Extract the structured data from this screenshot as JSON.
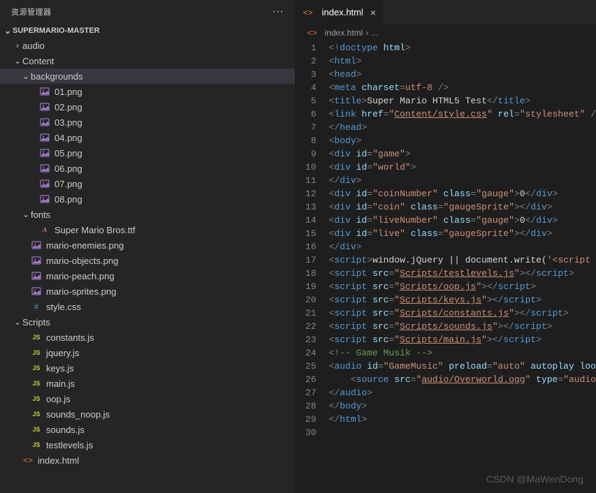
{
  "sidebar": {
    "title": "资源管理器",
    "project": "SUPERMARIO-MASTER",
    "tree": [
      {
        "label": "audio",
        "type": "folder",
        "open": false,
        "depth": 1
      },
      {
        "label": "Content",
        "type": "folder",
        "open": true,
        "depth": 1
      },
      {
        "label": "backgrounds",
        "type": "folder",
        "open": true,
        "depth": 2,
        "selected": true
      },
      {
        "label": "01.png",
        "type": "img",
        "depth": 3
      },
      {
        "label": "02.png",
        "type": "img",
        "depth": 3
      },
      {
        "label": "03.png",
        "type": "img",
        "depth": 3
      },
      {
        "label": "04.png",
        "type": "img",
        "depth": 3
      },
      {
        "label": "05.png",
        "type": "img",
        "depth": 3
      },
      {
        "label": "06.png",
        "type": "img",
        "depth": 3
      },
      {
        "label": "07.png",
        "type": "img",
        "depth": 3
      },
      {
        "label": "08.png",
        "type": "img",
        "depth": 3
      },
      {
        "label": "fonts",
        "type": "folder",
        "open": true,
        "depth": 2
      },
      {
        "label": "Super Mario Bros.ttf",
        "type": "font",
        "depth": 3
      },
      {
        "label": "mario-enemies.png",
        "type": "img",
        "depth": 2
      },
      {
        "label": "mario-objects.png",
        "type": "img",
        "depth": 2
      },
      {
        "label": "mario-peach.png",
        "type": "img",
        "depth": 2
      },
      {
        "label": "mario-sprites.png",
        "type": "img",
        "depth": 2
      },
      {
        "label": "style.css",
        "type": "css",
        "depth": 2
      },
      {
        "label": "Scripts",
        "type": "folder",
        "open": true,
        "depth": 1
      },
      {
        "label": "constants.js",
        "type": "js",
        "depth": 2
      },
      {
        "label": "jquery.js",
        "type": "js",
        "depth": 2
      },
      {
        "label": "keys.js",
        "type": "js",
        "depth": 2
      },
      {
        "label": "main.js",
        "type": "js",
        "depth": 2
      },
      {
        "label": "oop.js",
        "type": "js",
        "depth": 2
      },
      {
        "label": "sounds_noop.js",
        "type": "js",
        "depth": 2
      },
      {
        "label": "sounds.js",
        "type": "js",
        "depth": 2
      },
      {
        "label": "testlevels.js",
        "type": "js",
        "depth": 2
      },
      {
        "label": "index.html",
        "type": "html",
        "depth": 1
      }
    ]
  },
  "editor": {
    "tab": {
      "filename": "index.html"
    },
    "breadcrumb": {
      "file": "index.html",
      "more": "..."
    },
    "lines": [
      {
        "n": 1,
        "tokens": [
          [
            "<!",
            "bracket"
          ],
          [
            "doctype ",
            "doctype"
          ],
          [
            "html",
            "attr"
          ],
          [
            ">",
            "bracket"
          ]
        ]
      },
      {
        "n": 2,
        "tokens": [
          [
            "<",
            "bracket"
          ],
          [
            "html",
            "tag"
          ],
          [
            ">",
            "bracket"
          ]
        ]
      },
      {
        "n": 3,
        "tokens": [
          [
            "<",
            "bracket"
          ],
          [
            "head",
            "tag"
          ],
          [
            ">",
            "bracket"
          ]
        ]
      },
      {
        "n": 4,
        "tokens": [
          [
            "<",
            "bracket"
          ],
          [
            "meta ",
            "tag"
          ],
          [
            "charset",
            "attr"
          ],
          [
            "=",
            "bracket"
          ],
          [
            "utf-8",
            "str"
          ],
          [
            " />",
            "bracket"
          ]
        ]
      },
      {
        "n": 5,
        "tokens": [
          [
            "<",
            "bracket"
          ],
          [
            "title",
            "tag"
          ],
          [
            ">",
            "bracket"
          ],
          [
            "Super Mario HTML5 Test",
            "text"
          ],
          [
            "</",
            "bracket"
          ],
          [
            "title",
            "tag"
          ],
          [
            ">",
            "bracket"
          ]
        ]
      },
      {
        "n": 6,
        "tokens": [
          [
            "<",
            "bracket"
          ],
          [
            "link ",
            "tag"
          ],
          [
            "href",
            "attr"
          ],
          [
            "=",
            "bracket"
          ],
          [
            "\"",
            "str"
          ],
          [
            "Content/style.css",
            "str-u"
          ],
          [
            "\" ",
            "str"
          ],
          [
            "rel",
            "attr"
          ],
          [
            "=",
            "bracket"
          ],
          [
            "\"stylesheet\"",
            "str"
          ],
          [
            " /",
            "bracket"
          ]
        ]
      },
      {
        "n": 7,
        "tokens": [
          [
            "</",
            "bracket"
          ],
          [
            "head",
            "tag"
          ],
          [
            ">",
            "bracket"
          ]
        ]
      },
      {
        "n": 8,
        "tokens": [
          [
            "<",
            "bracket"
          ],
          [
            "body",
            "tag"
          ],
          [
            ">",
            "bracket"
          ]
        ]
      },
      {
        "n": 9,
        "tokens": [
          [
            "<",
            "bracket"
          ],
          [
            "div ",
            "tag"
          ],
          [
            "id",
            "attr"
          ],
          [
            "=",
            "bracket"
          ],
          [
            "\"game\"",
            "str"
          ],
          [
            ">",
            "bracket"
          ]
        ]
      },
      {
        "n": 10,
        "tokens": [
          [
            "<",
            "bracket"
          ],
          [
            "div ",
            "tag"
          ],
          [
            "id",
            "attr"
          ],
          [
            "=",
            "bracket"
          ],
          [
            "\"world\"",
            "str"
          ],
          [
            ">",
            "bracket"
          ]
        ]
      },
      {
        "n": 11,
        "tokens": [
          [
            "</",
            "bracket"
          ],
          [
            "div",
            "tag"
          ],
          [
            ">",
            "bracket"
          ]
        ]
      },
      {
        "n": 12,
        "tokens": [
          [
            "<",
            "bracket"
          ],
          [
            "div ",
            "tag"
          ],
          [
            "id",
            "attr"
          ],
          [
            "=",
            "bracket"
          ],
          [
            "\"coinNumber\" ",
            "str"
          ],
          [
            "class",
            "attr"
          ],
          [
            "=",
            "bracket"
          ],
          [
            "\"gauge\"",
            "str"
          ],
          [
            ">",
            "bracket"
          ],
          [
            "0",
            "text"
          ],
          [
            "</",
            "bracket"
          ],
          [
            "div",
            "tag"
          ],
          [
            ">",
            "bracket"
          ]
        ]
      },
      {
        "n": 13,
        "tokens": [
          [
            "<",
            "bracket"
          ],
          [
            "div ",
            "tag"
          ],
          [
            "id",
            "attr"
          ],
          [
            "=",
            "bracket"
          ],
          [
            "\"coin\" ",
            "str"
          ],
          [
            "class",
            "attr"
          ],
          [
            "=",
            "bracket"
          ],
          [
            "\"gaugeSprite\"",
            "str"
          ],
          [
            ">",
            "bracket"
          ],
          [
            "</",
            "bracket"
          ],
          [
            "div",
            "tag"
          ],
          [
            ">",
            "bracket"
          ]
        ]
      },
      {
        "n": 14,
        "tokens": [
          [
            "<",
            "bracket"
          ],
          [
            "div ",
            "tag"
          ],
          [
            "id",
            "attr"
          ],
          [
            "=",
            "bracket"
          ],
          [
            "\"liveNumber\" ",
            "str"
          ],
          [
            "class",
            "attr"
          ],
          [
            "=",
            "bracket"
          ],
          [
            "\"gauge\"",
            "str"
          ],
          [
            ">",
            "bracket"
          ],
          [
            "0",
            "text"
          ],
          [
            "</",
            "bracket"
          ],
          [
            "div",
            "tag"
          ],
          [
            ">",
            "bracket"
          ]
        ]
      },
      {
        "n": 15,
        "tokens": [
          [
            "<",
            "bracket"
          ],
          [
            "div ",
            "tag"
          ],
          [
            "id",
            "attr"
          ],
          [
            "=",
            "bracket"
          ],
          [
            "\"live\" ",
            "str"
          ],
          [
            "class",
            "attr"
          ],
          [
            "=",
            "bracket"
          ],
          [
            "\"gaugeSprite\"",
            "str"
          ],
          [
            ">",
            "bracket"
          ],
          [
            "</",
            "bracket"
          ],
          [
            "div",
            "tag"
          ],
          [
            ">",
            "bracket"
          ]
        ]
      },
      {
        "n": 16,
        "tokens": [
          [
            "</",
            "bracket"
          ],
          [
            "div",
            "tag"
          ],
          [
            ">",
            "bracket"
          ]
        ]
      },
      {
        "n": 17,
        "tokens": [
          [
            "<",
            "bracket"
          ],
          [
            "script",
            "tag"
          ],
          [
            ">",
            "bracket"
          ],
          [
            "window.jQuery || document.write(",
            "text"
          ],
          [
            "'<script ",
            "str"
          ]
        ]
      },
      {
        "n": 18,
        "tokens": [
          [
            "<",
            "bracket"
          ],
          [
            "script ",
            "tag"
          ],
          [
            "src",
            "attr"
          ],
          [
            "=",
            "bracket"
          ],
          [
            "\"",
            "str"
          ],
          [
            "Scripts/testlevels.js",
            "str-u"
          ],
          [
            "\"",
            "str"
          ],
          [
            ">",
            "bracket"
          ],
          [
            "</",
            "bracket"
          ],
          [
            "script",
            "tag"
          ],
          [
            ">",
            "bracket"
          ]
        ]
      },
      {
        "n": 19,
        "tokens": [
          [
            "<",
            "bracket"
          ],
          [
            "script ",
            "tag"
          ],
          [
            "src",
            "attr"
          ],
          [
            "=",
            "bracket"
          ],
          [
            "\"",
            "str"
          ],
          [
            "Scripts/oop.js",
            "str-u"
          ],
          [
            "\"",
            "str"
          ],
          [
            ">",
            "bracket"
          ],
          [
            "</",
            "bracket"
          ],
          [
            "script",
            "tag"
          ],
          [
            ">",
            "bracket"
          ]
        ]
      },
      {
        "n": 20,
        "tokens": [
          [
            "<",
            "bracket"
          ],
          [
            "script ",
            "tag"
          ],
          [
            "src",
            "attr"
          ],
          [
            "=",
            "bracket"
          ],
          [
            "\"",
            "str"
          ],
          [
            "Scripts/keys.js",
            "str-u"
          ],
          [
            "\"",
            "str"
          ],
          [
            ">",
            "bracket"
          ],
          [
            "</",
            "bracket"
          ],
          [
            "script",
            "tag"
          ],
          [
            ">",
            "bracket"
          ]
        ]
      },
      {
        "n": 21,
        "tokens": [
          [
            "<",
            "bracket"
          ],
          [
            "script ",
            "tag"
          ],
          [
            "src",
            "attr"
          ],
          [
            "=",
            "bracket"
          ],
          [
            "\"",
            "str"
          ],
          [
            "Scripts/constants.js",
            "str-u"
          ],
          [
            "\"",
            "str"
          ],
          [
            ">",
            "bracket"
          ],
          [
            "</",
            "bracket"
          ],
          [
            "script",
            "tag"
          ],
          [
            ">",
            "bracket"
          ]
        ]
      },
      {
        "n": 22,
        "tokens": [
          [
            "<",
            "bracket"
          ],
          [
            "script ",
            "tag"
          ],
          [
            "src",
            "attr"
          ],
          [
            "=",
            "bracket"
          ],
          [
            "\"",
            "str"
          ],
          [
            "Scripts/sounds.js",
            "str-u"
          ],
          [
            "\"",
            "str"
          ],
          [
            ">",
            "bracket"
          ],
          [
            "</",
            "bracket"
          ],
          [
            "script",
            "tag"
          ],
          [
            ">",
            "bracket"
          ]
        ]
      },
      {
        "n": 23,
        "tokens": [
          [
            "<",
            "bracket"
          ],
          [
            "script ",
            "tag"
          ],
          [
            "src",
            "attr"
          ],
          [
            "=",
            "bracket"
          ],
          [
            "\"",
            "str"
          ],
          [
            "Scripts/main.js",
            "str-u"
          ],
          [
            "\"",
            "str"
          ],
          [
            ">",
            "bracket"
          ],
          [
            "</",
            "bracket"
          ],
          [
            "script",
            "tag"
          ],
          [
            ">",
            "bracket"
          ]
        ]
      },
      {
        "n": 24,
        "tokens": [
          [
            "<!-- Game Musik -->",
            "comment"
          ]
        ]
      },
      {
        "n": 25,
        "tokens": [
          [
            "<",
            "bracket"
          ],
          [
            "audio ",
            "tag"
          ],
          [
            "id",
            "attr"
          ],
          [
            "=",
            "bracket"
          ],
          [
            "\"GameMusic\" ",
            "str"
          ],
          [
            "preload",
            "attr"
          ],
          [
            "=",
            "bracket"
          ],
          [
            "\"auto\" ",
            "str"
          ],
          [
            "autoplay ",
            "attr"
          ],
          [
            "loo",
            "attr"
          ]
        ]
      },
      {
        "n": 26,
        "tokens": [
          [
            "    ",
            "text"
          ],
          [
            "<",
            "bracket"
          ],
          [
            "source ",
            "tag"
          ],
          [
            "src",
            "attr"
          ],
          [
            "=",
            "bracket"
          ],
          [
            "\"",
            "str"
          ],
          [
            "audio/Overworld.ogg",
            "str-u"
          ],
          [
            "\" ",
            "str"
          ],
          [
            "type",
            "attr"
          ],
          [
            "=",
            "bracket"
          ],
          [
            "\"audio",
            "str"
          ]
        ]
      },
      {
        "n": 27,
        "tokens": [
          [
            "</",
            "bracket"
          ],
          [
            "audio",
            "tag"
          ],
          [
            ">",
            "bracket"
          ]
        ]
      },
      {
        "n": 28,
        "tokens": [
          [
            "</",
            "bracket"
          ],
          [
            "body",
            "tag"
          ],
          [
            ">",
            "bracket"
          ]
        ]
      },
      {
        "n": 29,
        "tokens": [
          [
            "</",
            "bracket"
          ],
          [
            "html",
            "tag"
          ],
          [
            ">",
            "bracket"
          ]
        ]
      },
      {
        "n": 30,
        "tokens": []
      }
    ]
  },
  "watermark": "CSDN @MaWenDong"
}
